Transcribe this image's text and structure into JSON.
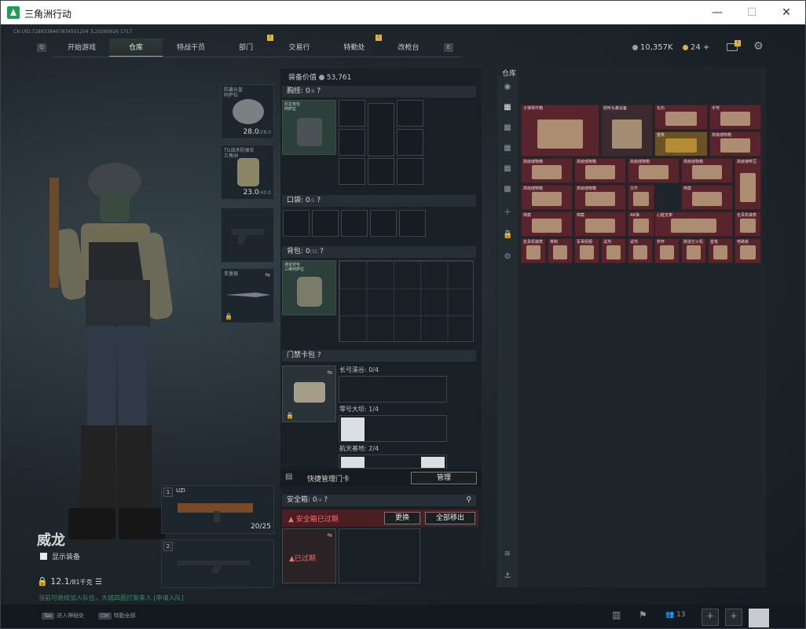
{
  "window": {
    "title": "三角洲行动",
    "controls": {
      "minimize": "—",
      "maximize": "☐",
      "close": "✕"
    }
  },
  "uid": "CN UID:7288338407834501204 3,20260926 1717",
  "nav": {
    "left_key": "Q",
    "right_key": "E",
    "tabs": [
      "开始游戏",
      "仓库",
      "特战干员",
      "部门",
      "交易行",
      "特勤处",
      "改枪台"
    ],
    "active": "仓库",
    "badges": [
      "!",
      "!"
    ]
  },
  "currency": {
    "coins": "10,357K",
    "tickets": "24",
    "plus": "+",
    "mail_badge": "!"
  },
  "character": {
    "name": "威龙",
    "show_gear": "显示装备",
    "weight": "12.1",
    "weight_max": "/81千克"
  },
  "equipment_slots": [
    {
      "label": "防暴头盔\n阿萨拉",
      "dur": "28.0",
      "dur_max": "/28.0"
    },
    {
      "label": "TG战术防弹衣\n三角洲",
      "dur": "23.0",
      "dur_max": "/40.0"
    },
    {
      "label": "",
      "dur": "",
      "dur_max": ""
    },
    {
      "label": "变量器",
      "dur": "",
      "dur_max": ""
    }
  ],
  "weapons": [
    {
      "slot": "1",
      "name": "UZI",
      "ammo": "20/25"
    },
    {
      "slot": "2",
      "name": "",
      "ammo": ""
    }
  ],
  "gear": {
    "value_label": "装备价值",
    "value": "53,761",
    "chest_label": "胸挂",
    "chest_cap": "0",
    "chest_note": "/8",
    "chest_item": "尼龙背包\n阿萨拉",
    "pocket_label": "口袋",
    "pocket_cap": "0",
    "pocket_note": "/5",
    "backpack_label": "背包",
    "backpack_cap": "0",
    "backpack_note": "/35",
    "backpack_item": "通道背包\n三维阿萨拉",
    "keycard_label": "门禁卡包",
    "keycards": [
      {
        "name": "长弓溪谷",
        "count": "0/4"
      },
      {
        "name": "零号大坝",
        "count": "1/4"
      },
      {
        "name": "航天基地",
        "count": "2/4"
      }
    ],
    "quick_label": "快捷管理门卡",
    "manage": "管理",
    "safe_label": "安全箱",
    "safe_cap": "0",
    "safe_note": "/4",
    "safe_warning": "安全箱已过期",
    "replace": "更换",
    "remove_all": "全部移出",
    "expired": "已过期"
  },
  "warehouse": {
    "title": "仓库",
    "items": [
      {
        "label": "子弹零件箱",
        "bg": "red"
      },
      {
        "label": "助听头戴设备",
        "bg": "dark"
      },
      {
        "label": "化石",
        "bg": "red"
      },
      {
        "label": "手弩",
        "bg": "red"
      },
      {
        "label": "金条",
        "bg": "gold"
      },
      {
        "label": "高级储物箱",
        "bg": "red"
      },
      {
        "label": "高级储物箱",
        "bg": "red"
      },
      {
        "label": "高级储物箱",
        "bg": "red"
      },
      {
        "label": "高级储物箱",
        "bg": "red"
      },
      {
        "label": "高级储物箱",
        "bg": "red"
      },
      {
        "label": "高级咖啡豆",
        "bg": "red"
      },
      {
        "label": "高级储物箱",
        "bg": "red"
      },
      {
        "label": "高级储物箱",
        "bg": "red"
      },
      {
        "label": "文件",
        "bg": "red"
      },
      {
        "label": "档案",
        "bg": "red"
      },
      {
        "label": "档案",
        "bg": "red"
      },
      {
        "label": "档案",
        "bg": "red"
      },
      {
        "label": "AR弹",
        "bg": "red"
      },
      {
        "label": "心脏支架",
        "bg": "red"
      },
      {
        "label": "名贵机械表",
        "bg": "red"
      },
      {
        "label": "名贵机械表",
        "bg": "red"
      },
      {
        "label": "骨制",
        "bg": "red"
      },
      {
        "label": "军事情报",
        "bg": "red"
      },
      {
        "label": "试剂",
        "bg": "red"
      },
      {
        "label": "试剂",
        "bg": "red"
      },
      {
        "label": "奖杯",
        "bg": "red"
      },
      {
        "label": "跨进打火机",
        "bg": "red"
      },
      {
        "label": "金笔",
        "bg": "red"
      },
      {
        "label": "电路板",
        "bg": "red"
      }
    ]
  },
  "bottom": {
    "hint": "当前可继续加入队伍，大城四面打架来人 [申请入队]",
    "keys": [
      {
        "key": "Tab",
        "label": "进入神秘处"
      },
      {
        "key": "Ctrl",
        "label": "特勤全部"
      }
    ],
    "friends": "13"
  }
}
